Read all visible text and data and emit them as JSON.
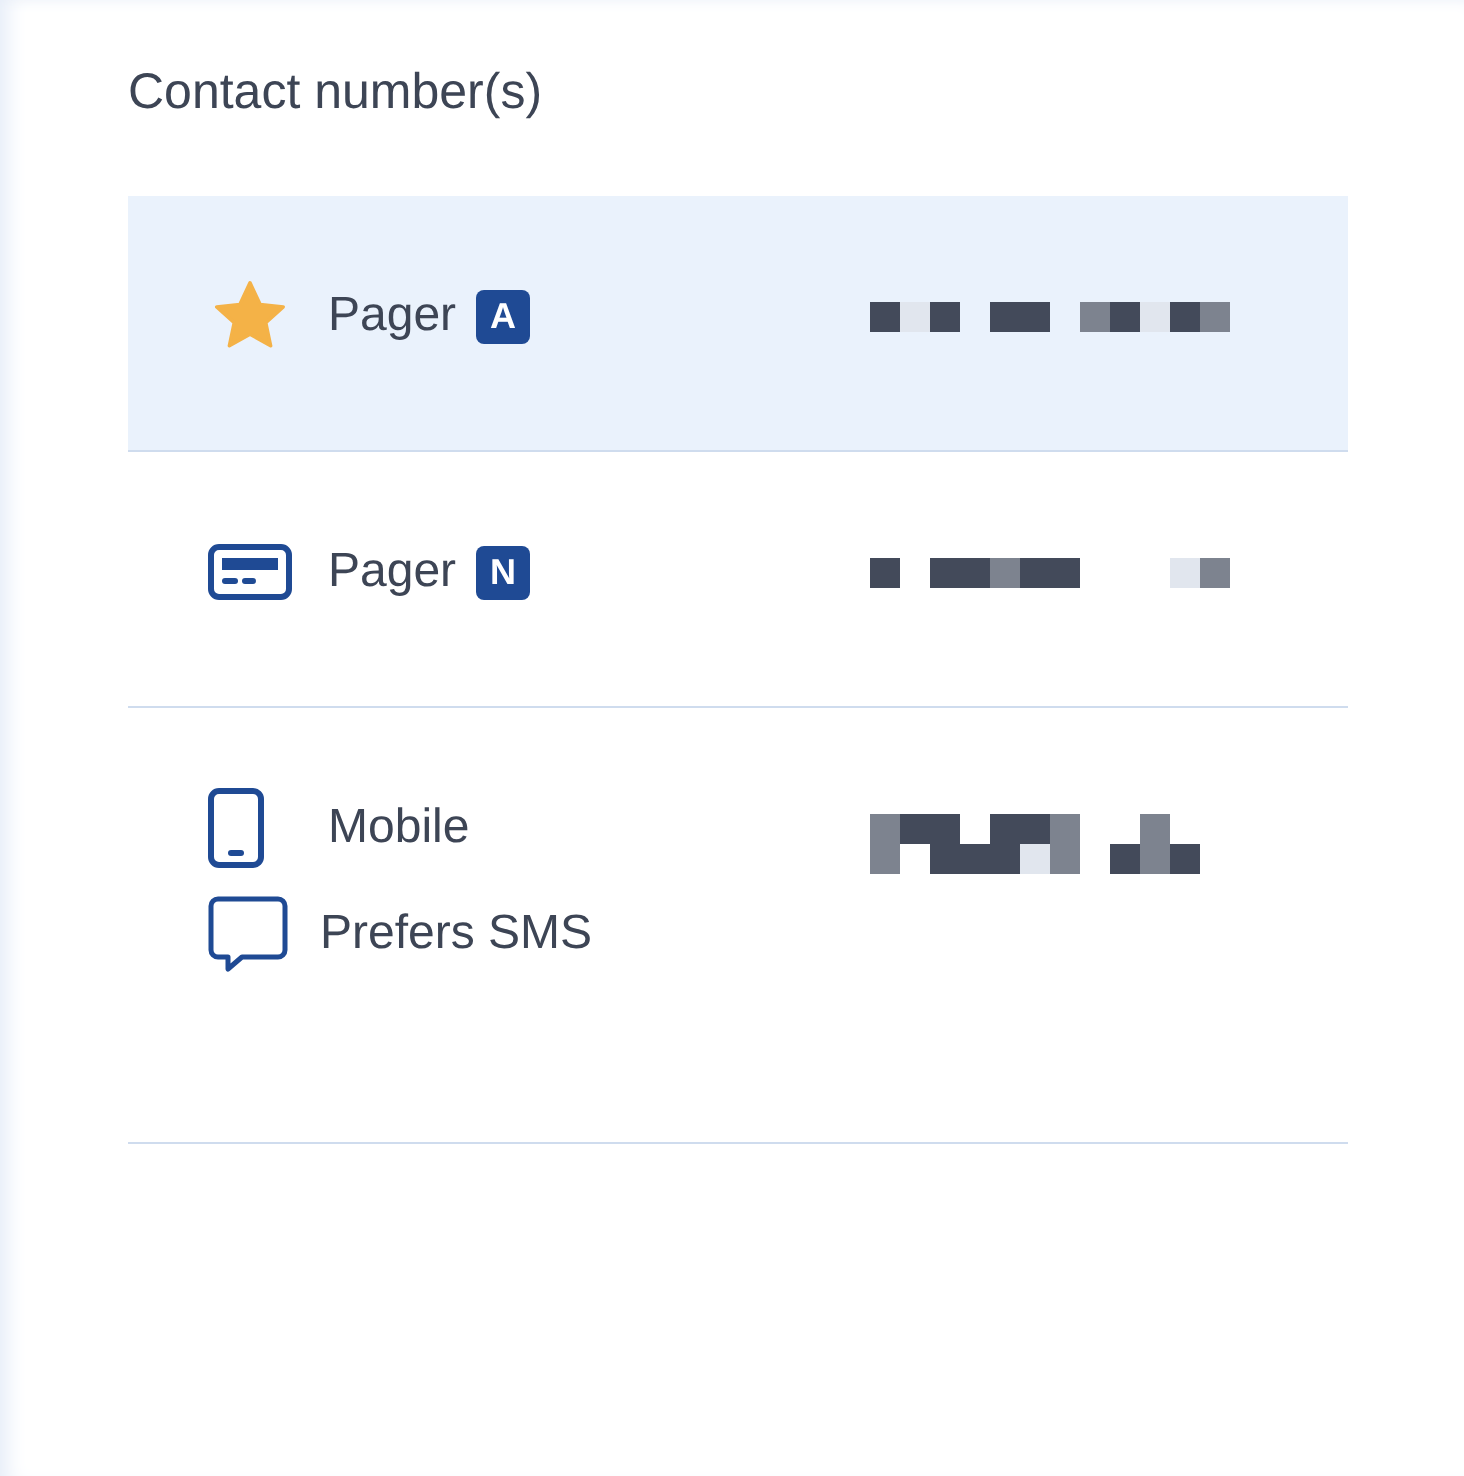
{
  "heading": "Contact number(s)",
  "contacts": [
    {
      "kind": "favorite",
      "label": "Pager",
      "badge": "A",
      "selected": true
    },
    {
      "kind": "pager",
      "label": "Pager",
      "badge": "N",
      "selected": false
    },
    {
      "kind": "mobile",
      "label": "Mobile",
      "note": "Prefers SMS",
      "selected": false
    }
  ]
}
